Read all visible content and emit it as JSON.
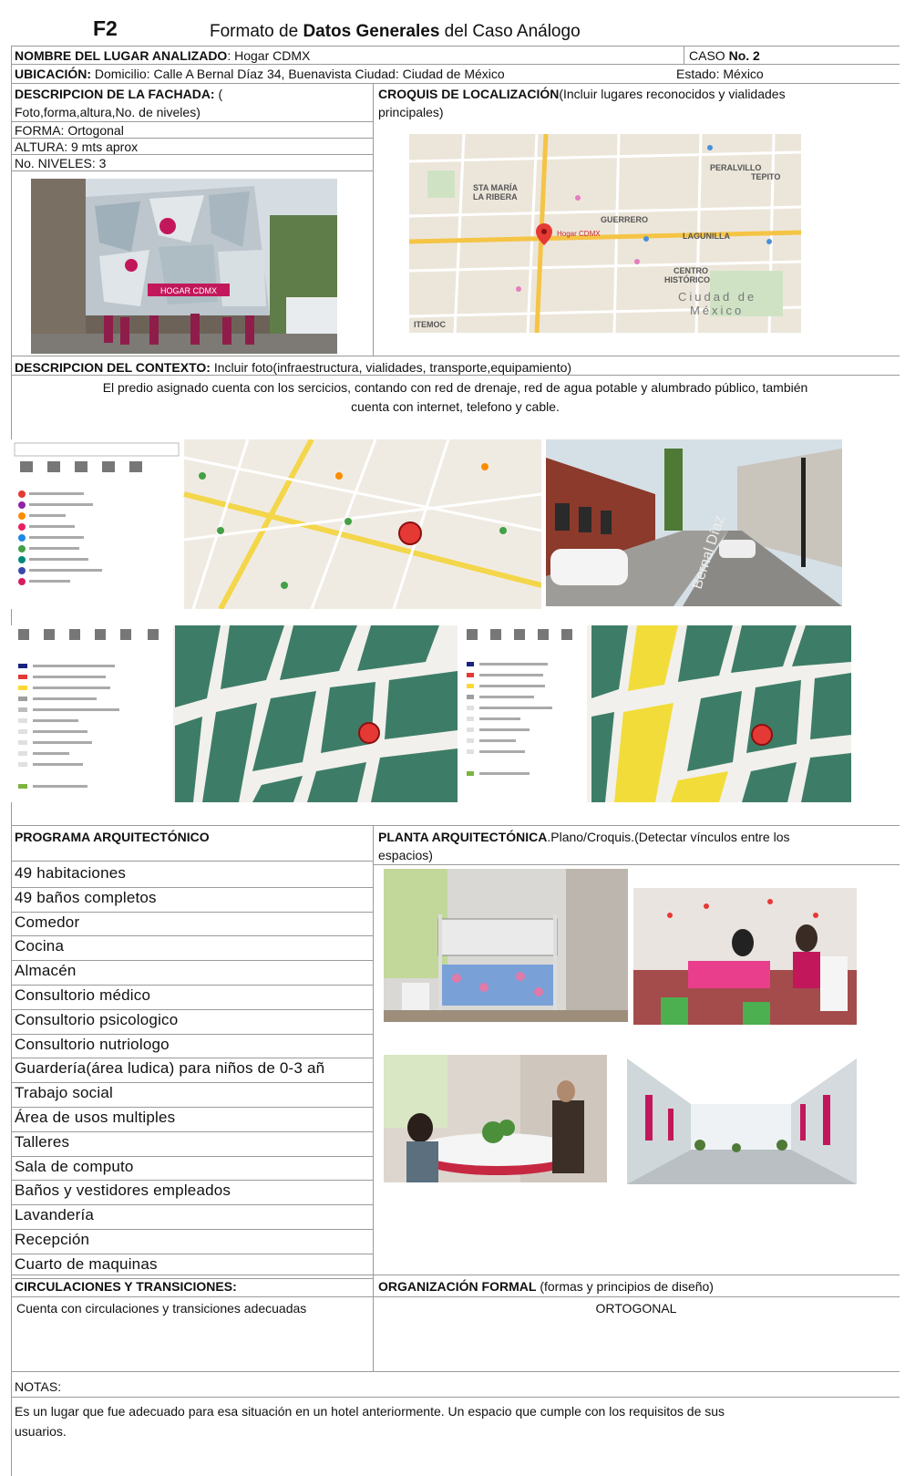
{
  "header": {
    "code": "F2",
    "title_prefix": "Formato de ",
    "title_bold": "Datos Generales",
    "title_suffix": " del Caso Análogo"
  },
  "row1": {
    "label": "NOMBRE DEL LUGAR ANALIZADO",
    "value": ": Hogar CDMX",
    "case_label": "CASO ",
    "case_value": "No. 2"
  },
  "row2": {
    "label": "UBICACIÓN:",
    "value": " Domicilio: Calle A Bernal Díaz 34, Buenavista   Ciudad:  Ciudad de México",
    "state": "Estado:  México"
  },
  "facade": {
    "label": "DESCRIPCION DE LA FACHADA:",
    "label_tail": "  (",
    "line2": "Foto,forma,altura,No. de niveles)",
    "forma": "FORMA: Ortogonal",
    "altura": "ALTURA: 9 mts aprox",
    "niveles": "No. NIVELES: 3",
    "sign": "HOGAR CDMX"
  },
  "croquis": {
    "label": "CROQUIS DE LOCALIZACIÓN",
    "label_tail": "(Incluir lugares reconocidos y vialidades",
    "line2": "principales)",
    "map_labels": {
      "a": "STA MARÍA",
      "b": "LA RIBERA",
      "c": "GUERRERO",
      "d": "PERALVILLO",
      "e": "LAGUNILLA",
      "f": "CENTRO",
      "g": "HISTÓRICO",
      "h": "Ciudad de",
      "i": "México",
      "j": "Hogar CDMX",
      "k": "TEPITO",
      "l": "ITEMOC"
    }
  },
  "context": {
    "label": "DESCRIPCION DEL CONTEXTO:",
    "label_tail": " Incluir foto(infraestructura, vialidades, transporte,equipamiento)",
    "text1": "El predio asignado cuenta con los sercicios, contando con red de drenaje, red de agua potable y alumbrado público, también",
    "text2": "cuenta con internet, telefono y cable.",
    "street_sign": "Bernal Díaz"
  },
  "program": {
    "label": "PROGRAMA ARQUITECTÓNICO",
    "items": [
      "49 habitaciones",
      "49 baños completos",
      "Comedor",
      "Cocina",
      "Almacén",
      "Consultorio médico",
      "Consultorio psicologico",
      "Consultorio nutriologo",
      "Guardería(área ludica) para niños de 0-3 añ",
      "Trabajo social",
      "Área de usos multiples",
      "Talleres",
      "Sala de computo",
      "Baños y vestidores empleados",
      "Lavandería",
      "Recepción",
      "Cuarto de maquinas"
    ]
  },
  "planta": {
    "label": "PLANTA ARQUITECTÓNICA",
    "label_tail": ".Plano/Croquis.(Detectar vínculos entre los",
    "line2": "espacios)"
  },
  "circ": {
    "label": "CIRCULACIONES Y TRANSICIONES:",
    "text": "Cuenta con circulaciones y transiciones adecuadas"
  },
  "org": {
    "label": "ORGANIZACIÓN FORMAL",
    "label_tail": " (formas y principios de diseño)",
    "text": "ORTOGONAL"
  },
  "notes": {
    "label": "NOTAS:",
    "text1": "Es un lugar que fue adecuado para esa situación en un hotel anteriormente. Un espacio que cumple con los requisitos de sus",
    "text2": "usuarios."
  }
}
